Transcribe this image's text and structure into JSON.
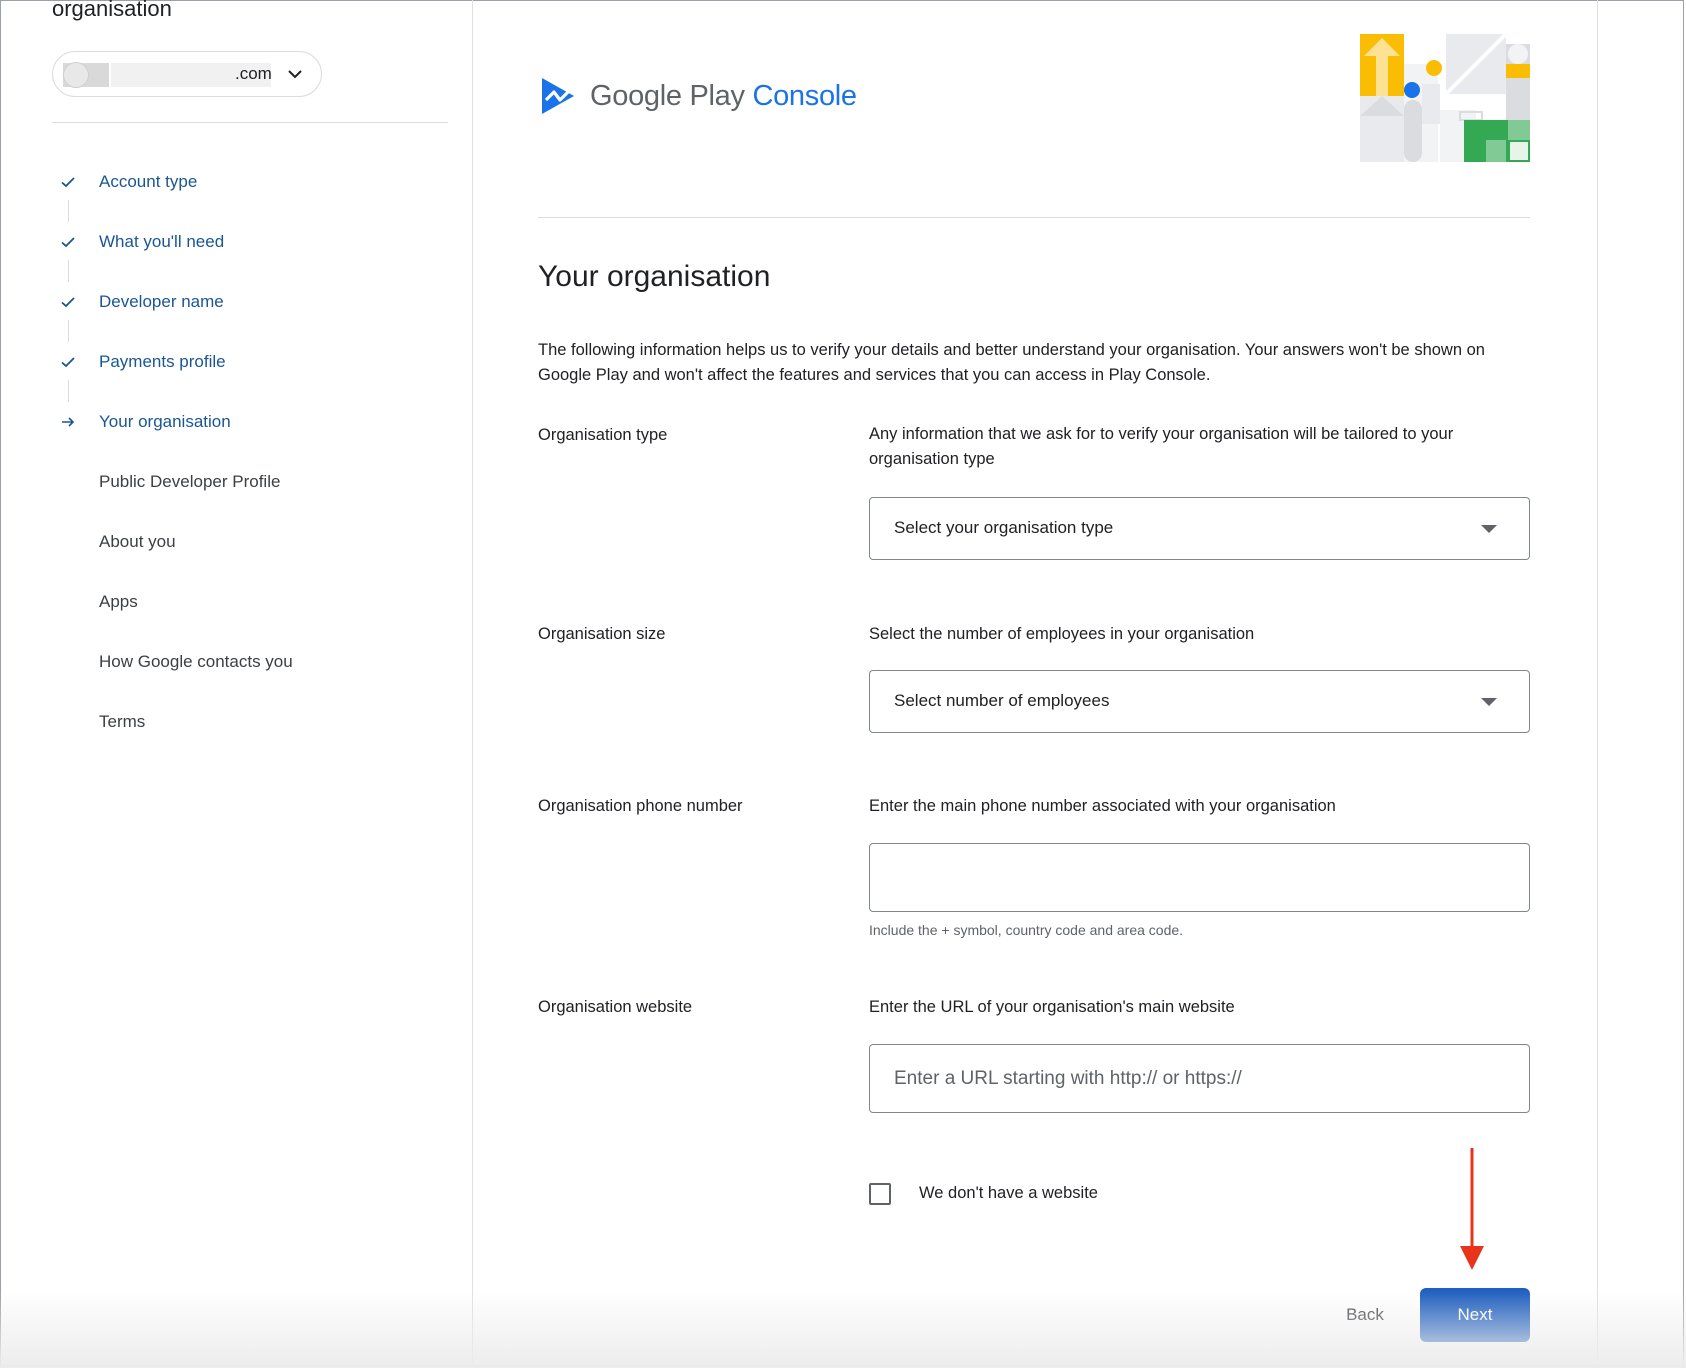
{
  "sidebar": {
    "title": "organisation",
    "account": {
      "suffix": ".com"
    },
    "steps": [
      {
        "label": "Account type",
        "status": "done"
      },
      {
        "label": "What you'll need",
        "status": "done"
      },
      {
        "label": "Developer name",
        "status": "done"
      },
      {
        "label": "Payments profile",
        "status": "done"
      },
      {
        "label": "Your organisation",
        "status": "current"
      },
      {
        "label": "Public Developer Profile",
        "status": "todo"
      },
      {
        "label": "About you",
        "status": "todo"
      },
      {
        "label": "Apps",
        "status": "todo"
      },
      {
        "label": "How Google contacts you",
        "status": "todo"
      },
      {
        "label": "Terms",
        "status": "todo"
      }
    ]
  },
  "header": {
    "brand_google_play": "Google Play",
    "brand_console": "Console"
  },
  "main": {
    "title": "Your organisation",
    "intro": "The following information helps us to verify your details and better understand your organisation. Your answers won't be shown on Google Play and won't affect the features and services that you can access in Play Console.",
    "org_type": {
      "label": "Organisation type",
      "description": "Any information that we ask for to verify your organisation will be tailored to your organisation type",
      "select_value": "Select your organisation type"
    },
    "org_size": {
      "label": "Organisation size",
      "description": "Select the number of employees in your organisation",
      "select_value": "Select number of employees"
    },
    "org_phone": {
      "label": "Organisation phone number",
      "description": "Enter the main phone number associated with your organisation",
      "value": "",
      "helper": "Include the + symbol, country code and area code."
    },
    "org_website": {
      "label": "Organisation website",
      "description": "Enter the URL of your organisation's main website",
      "value": "",
      "placeholder": "Enter a URL starting with http:// or https://"
    },
    "no_website": {
      "label": "We don't have a website",
      "checked": false
    }
  },
  "footer": {
    "back_label": "Back",
    "next_label": "Next"
  },
  "colors": {
    "link_blue": "#1a5694",
    "primary_button": "#1f5fbf",
    "annotation_red": "#e8341c",
    "brand_blue": "#1a73e8"
  }
}
